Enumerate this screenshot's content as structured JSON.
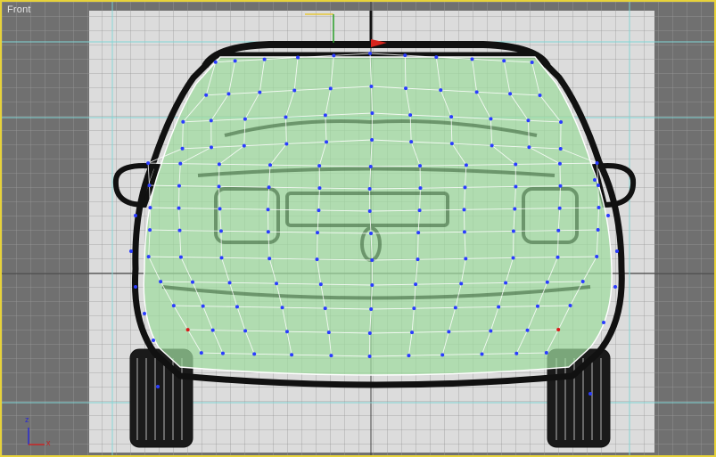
{
  "viewport": {
    "label": "Front",
    "active_border_color": "#e7d23a",
    "background_color": "#707070",
    "blueprint_color": "#dcdcdc",
    "mesh_color": "#9fdc9f"
  },
  "gizmo": {
    "x_axis_color": "#d8241c",
    "y_axis_color": "#e7c83a"
  },
  "axis_tripod": {
    "up_label": "z",
    "right_label": "x",
    "up_color": "#2a2ad0",
    "right_color": "#c42020"
  },
  "scene": {
    "object": "car-rear-view-mesh",
    "grid": true,
    "vertex_color": "#2a3cff",
    "selected_vertex_color": "#d81a1a"
  }
}
